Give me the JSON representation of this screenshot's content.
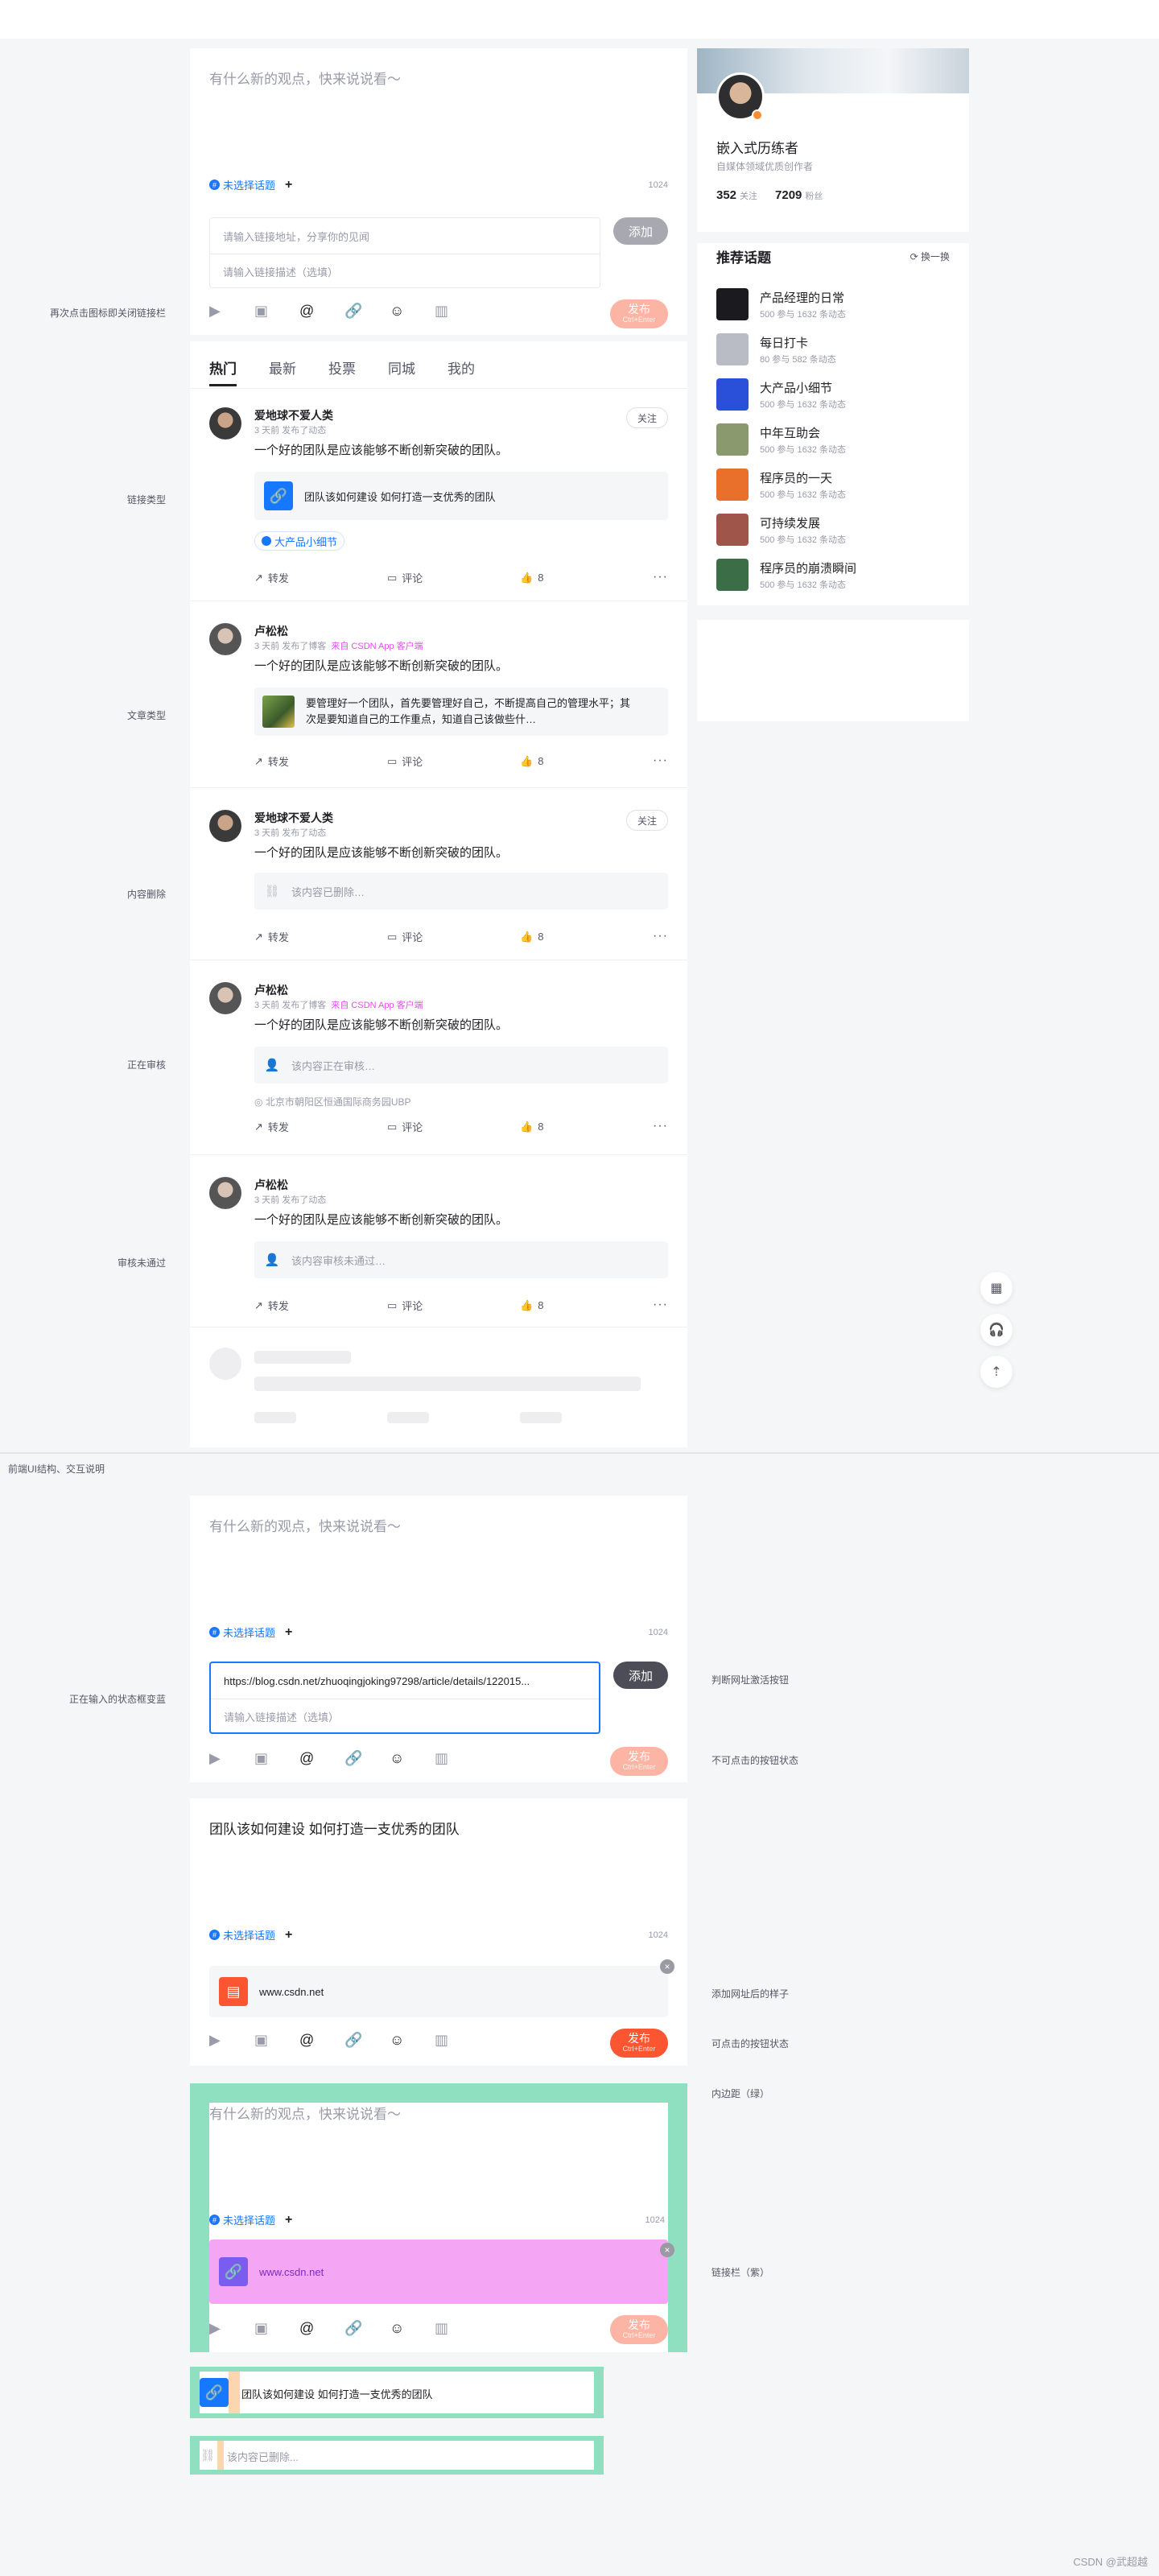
{
  "composer": {
    "placeholder": "有什么新的观点，快来说说看～",
    "topic_label": "未选择话题",
    "plus": "+",
    "count": "1024",
    "link_url_placeholder": "请输入链接地址，分享你的见闻",
    "link_desc_placeholder": "请输入链接描述（选填）",
    "add_label": "添加",
    "publish_label": "发布",
    "publish_hint": "Ctrl+Enter",
    "at_label": "@"
  },
  "annotations": {
    "close_link_bar": "再次点击图标即关闭链接栏",
    "link_type": "链接类型",
    "article_type": "文章类型",
    "content_deleted": "内容删除",
    "under_review": "正在审核",
    "review_failed": "审核未通过",
    "section_desc": "前端UI结构、交互说明",
    "input_state": "正在输入的状态框变蓝",
    "activate_btn": "判断网址激活按钮",
    "disabled_btn": "不可点击的按钮状态",
    "after_add": "添加网址后的样子",
    "clickable_btn": "可点击的按钮状态",
    "padding_green": "内边距（绿）",
    "link_bar_purple": "链接栏（紫）"
  },
  "feed": {
    "tabs": [
      "热门",
      "最新",
      "投票",
      "同城",
      "我的"
    ],
    "posts": [
      {
        "user": "爱地球不爱人类",
        "meta": "3 天前 发布了动态",
        "source": "",
        "text": "一个好的团队是应该能够不断创新突破的团队。",
        "card": "团队该如何建设 如何打造一支优秀的团队",
        "tag": "大产品小细节",
        "follow": "关注",
        "likes": "8"
      },
      {
        "user": "卢松松",
        "meta": "3 天前 发布了博客",
        "source": "来自 CSDN App 客户端",
        "text": "一个好的团队是应该能够不断创新突破的团队。",
        "card_line1": "要管理好一个团队，首先要管理好自己，不断提高自己的管理水平；其",
        "card_line2": "次是要知道自己的工作重点，知道自己该做些什…",
        "likes": "8"
      },
      {
        "user": "爱地球不爱人类",
        "meta": "3 天前 发布了动态",
        "source": "",
        "text": "一个好的团队是应该能够不断创新突破的团队。",
        "card": "该内容已删除…",
        "follow": "关注",
        "likes": "8"
      },
      {
        "user": "卢松松",
        "meta": "3 天前 发布了博客",
        "source": "来自 CSDN App 客户端",
        "text": "一个好的团队是应该能够不断创新突破的团队。",
        "card": "该内容正在审核…",
        "location": "北京市朝阳区恒通国际商务园UBP",
        "likes": "8"
      },
      {
        "user": "卢松松",
        "meta": "3 天前 发布了动态",
        "source": "",
        "text": "一个好的团队是应该能够不断创新突破的团队。",
        "card": "该内容审核未通过…",
        "likes": "8"
      }
    ],
    "forward": "转发",
    "comment": "评论",
    "more": "···"
  },
  "profile": {
    "name": "嵌入式历练者",
    "desc": "自媒体领域优质创作者",
    "follows": "352",
    "follows_label": "关注",
    "fans": "7209",
    "fans_label": "粉丝"
  },
  "topics": {
    "title": "推荐话题",
    "refresh": "换一换",
    "items": [
      {
        "name": "产品经理的日常",
        "meta": "500 参与   1632 条动态",
        "color": "#1b1b1f"
      },
      {
        "name": "每日打卡",
        "meta": "80 参与   582 条动态",
        "color": "#b9bcc4"
      },
      {
        "name": "大产品小细节",
        "meta": "500 参与   1632 条动态",
        "color": "#2a4fd8"
      },
      {
        "name": "中年互助会",
        "meta": "500 参与   1632 条动态",
        "color": "#8a9a6e"
      },
      {
        "name": "程序员的一天",
        "meta": "500 参与   1632 条动态",
        "color": "#e8702a"
      },
      {
        "name": "可持续发展",
        "meta": "500 参与   1632 条动态",
        "color": "#a0554a"
      },
      {
        "name": "程序员的崩溃瞬间",
        "meta": "500 参与   1632 条动态",
        "color": "#3b6e46"
      }
    ]
  },
  "lower": {
    "typed_url": "https://blog.csdn.net/zhuoqingjoking97298/article/details/122015...",
    "title_text": "团队该如何建设 如何打造一支优秀的团队",
    "site": "www.csdn.net",
    "card_text": "团队该如何建设 如何打造一支优秀的团队",
    "deleted_text": "该内容已删除..."
  },
  "watermark": "CSDN @武超越",
  "colors": {
    "publish_disabled": "#fcb5a4",
    "publish_active": "#fc5531",
    "add_disabled": "#a8a8b0",
    "add_active": "#4d4d58",
    "green": "#8fe0c0",
    "purple": "#f4a6f4"
  }
}
